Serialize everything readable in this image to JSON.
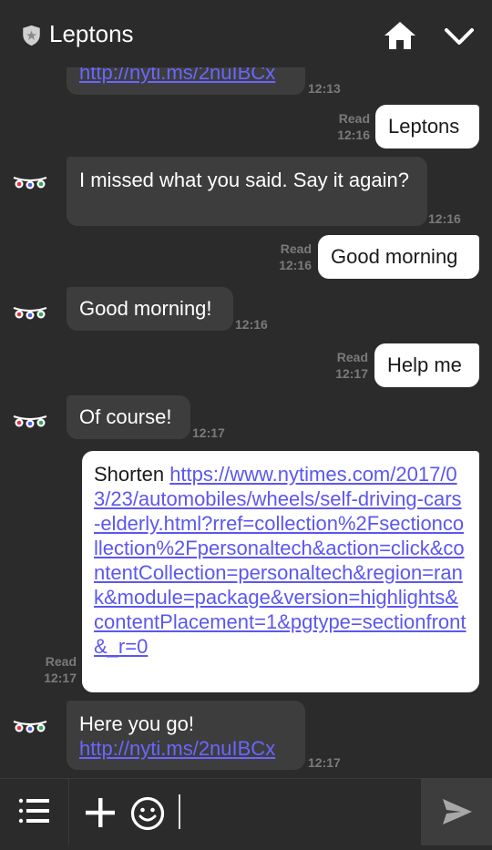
{
  "header": {
    "title": "Leptons"
  },
  "messages": [
    {
      "id": "m0",
      "direction": "in",
      "text": "",
      "link": "http://nyti.ms/2nuIBCx",
      "time": "12:13"
    },
    {
      "id": "m1",
      "direction": "out",
      "text": "Leptons",
      "read": "Read",
      "time": "12:16"
    },
    {
      "id": "m2",
      "direction": "in",
      "text": "I missed what you said. Say it again?",
      "time": "12:16"
    },
    {
      "id": "m3",
      "direction": "out",
      "text": "Good morning",
      "read": "Read",
      "time": "12:16"
    },
    {
      "id": "m4",
      "direction": "in",
      "text": "Good morning!",
      "time": "12:16"
    },
    {
      "id": "m5",
      "direction": "out",
      "text": "Help me",
      "read": "Read",
      "time": "12:17"
    },
    {
      "id": "m6",
      "direction": "in",
      "text": "Of course!",
      "time": "12:17"
    },
    {
      "id": "m7",
      "direction": "out",
      "text": "Shorten",
      "link": "https://www.nytimes.com/2017/03/23/automobiles/wheels/self-driving-cars-elderly.html?rref=collection%2Fsectioncollection%2Fpersonaltech&action=click&contentCollection=personaltech&region=rank&module=package&version=highlights&contentPlacement=1&pgtype=sectionfront&_r=0",
      "read": "Read",
      "time": "12:17"
    },
    {
      "id": "m8",
      "direction": "in",
      "text": "Here you go!",
      "link": "http://nyti.ms/2nuIBCx",
      "time": "12:17"
    }
  ],
  "composer": {
    "value": ""
  },
  "icons": {
    "shield": "shield-icon",
    "home": "home-icon",
    "chevron": "chevron-down-icon",
    "menu": "list-menu-icon",
    "plus": "plus-icon",
    "emoji": "smiley-icon",
    "send": "send-icon",
    "avatar": "bot-avatar-icon"
  },
  "colors": {
    "background": "#2b2b2b",
    "incoming_bubble": "#3d3d3d",
    "outgoing_bubble": "#ffffff",
    "link": "#5b57f0",
    "meta_text": "#7a7a7a"
  }
}
